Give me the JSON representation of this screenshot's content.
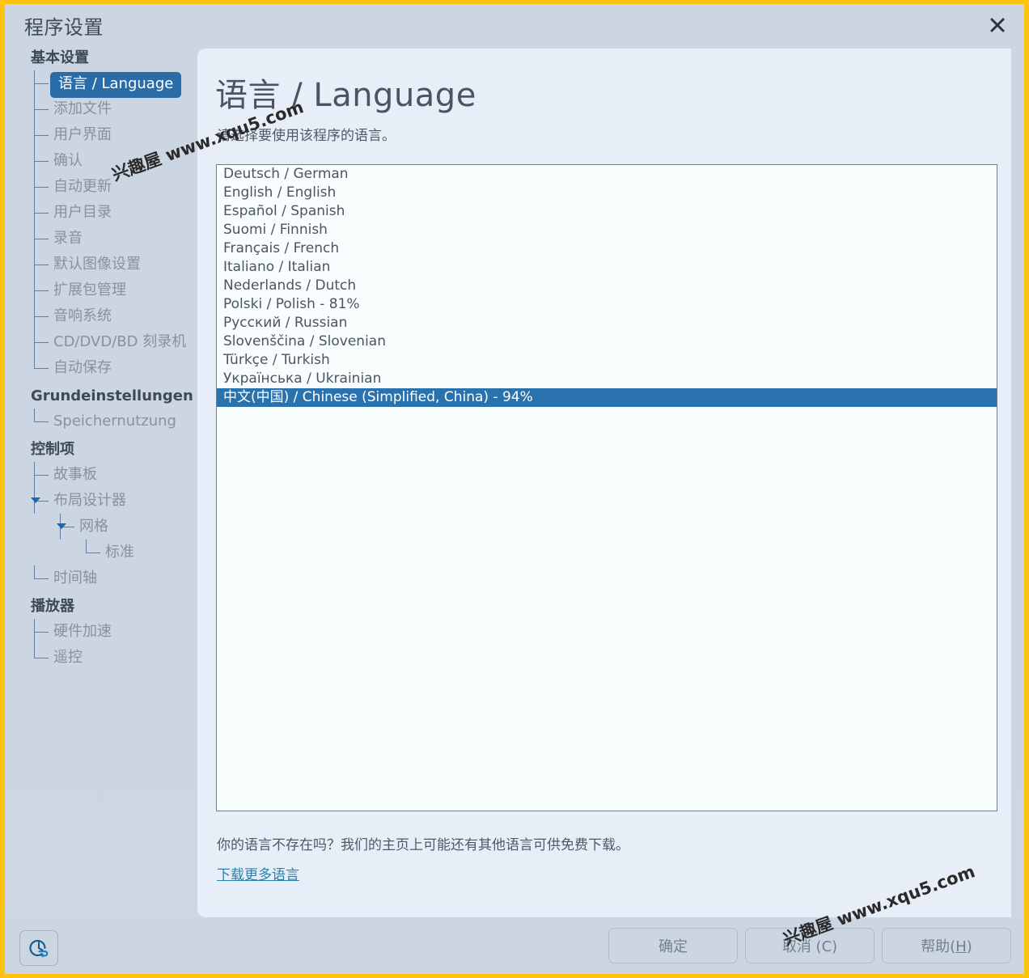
{
  "window": {
    "title": "程序设置",
    "close_icon": "close-icon",
    "border_color": "#ffc20e",
    "chrome_color": "#ccd5e2",
    "panel_color": "#e7eef7",
    "accent_color": "#2a6ca8"
  },
  "sidebar": {
    "groups": [
      {
        "title": "基本设置",
        "items": [
          {
            "label": "语言 / Language",
            "level": 1,
            "selected": true,
            "expander": false
          },
          {
            "label": "添加文件",
            "level": 1,
            "selected": false,
            "expander": false
          },
          {
            "label": "用户界面",
            "level": 1,
            "selected": false,
            "expander": false
          },
          {
            "label": "确认",
            "level": 1,
            "selected": false,
            "expander": false
          },
          {
            "label": "自动更新",
            "level": 1,
            "selected": false,
            "expander": false
          },
          {
            "label": "用户目录",
            "level": 1,
            "selected": false,
            "expander": false
          },
          {
            "label": "录音",
            "level": 1,
            "selected": false,
            "expander": false
          },
          {
            "label": "默认图像设置",
            "level": 1,
            "selected": false,
            "expander": false
          },
          {
            "label": "扩展包管理",
            "level": 1,
            "selected": false,
            "expander": false
          },
          {
            "label": "音响系统",
            "level": 1,
            "selected": false,
            "expander": false
          },
          {
            "label": "CD/DVD/BD 刻录机",
            "level": 1,
            "selected": false,
            "expander": false
          },
          {
            "label": "自动保存",
            "level": 1,
            "selected": false,
            "expander": false,
            "last": true
          }
        ]
      },
      {
        "title": "Grundeinstellungen",
        "items": [
          {
            "label": "Speichernutzung",
            "level": 1,
            "selected": false,
            "expander": false,
            "last": true
          }
        ]
      },
      {
        "title": "控制项",
        "items": [
          {
            "label": "故事板",
            "level": 1,
            "selected": false,
            "expander": false
          },
          {
            "label": "布局设计器",
            "level": 1,
            "selected": false,
            "expander": true
          },
          {
            "label": "网格",
            "level": 2,
            "selected": false,
            "expander": true
          },
          {
            "label": "标准",
            "level": 3,
            "selected": false,
            "expander": false,
            "last": true
          },
          {
            "label": "时间轴",
            "level": 1,
            "selected": false,
            "expander": false,
            "last": true
          }
        ]
      },
      {
        "title": "播放器",
        "items": [
          {
            "label": "硬件加速",
            "level": 1,
            "selected": false,
            "expander": false
          },
          {
            "label": "遥控",
            "level": 1,
            "selected": false,
            "expander": false,
            "last": true
          }
        ]
      }
    ]
  },
  "main": {
    "title": "语言 / Language",
    "subtitle": "请选择要使用该程序的语言。",
    "languages": [
      {
        "label": "Deutsch / German",
        "selected": false
      },
      {
        "label": "English / English",
        "selected": false
      },
      {
        "label": "Español / Spanish",
        "selected": false
      },
      {
        "label": "Suomi / Finnish",
        "selected": false
      },
      {
        "label": "Français / French",
        "selected": false
      },
      {
        "label": "Italiano / Italian",
        "selected": false
      },
      {
        "label": "Nederlands / Dutch",
        "selected": false
      },
      {
        "label": "Polski / Polish  -  81%",
        "selected": false
      },
      {
        "label": "Русский / Russian",
        "selected": false
      },
      {
        "label": "Slovenščina / Slovenian",
        "selected": false
      },
      {
        "label": "Türkçe / Turkish",
        "selected": false
      },
      {
        "label": "Українська / Ukrainian",
        "selected": false
      },
      {
        "label": "中文(中国) / Chinese (Simplified, China)  -  94%",
        "selected": true
      }
    ],
    "footer_note": "你的语言不存在吗？我们的主页上可能还有其他语言可供免费下载。",
    "download_link": "下载更多语言"
  },
  "bottom": {
    "reset_icon": "restore-defaults-icon",
    "ok_label": "确定",
    "cancel_label": "取消 (C)",
    "cancel_accel": "C",
    "help_label_prefix": "帮助(",
    "help_accel": "H",
    "help_label_suffix": ")"
  },
  "watermark": {
    "text": "兴趣屋 www.xqu5.com"
  }
}
